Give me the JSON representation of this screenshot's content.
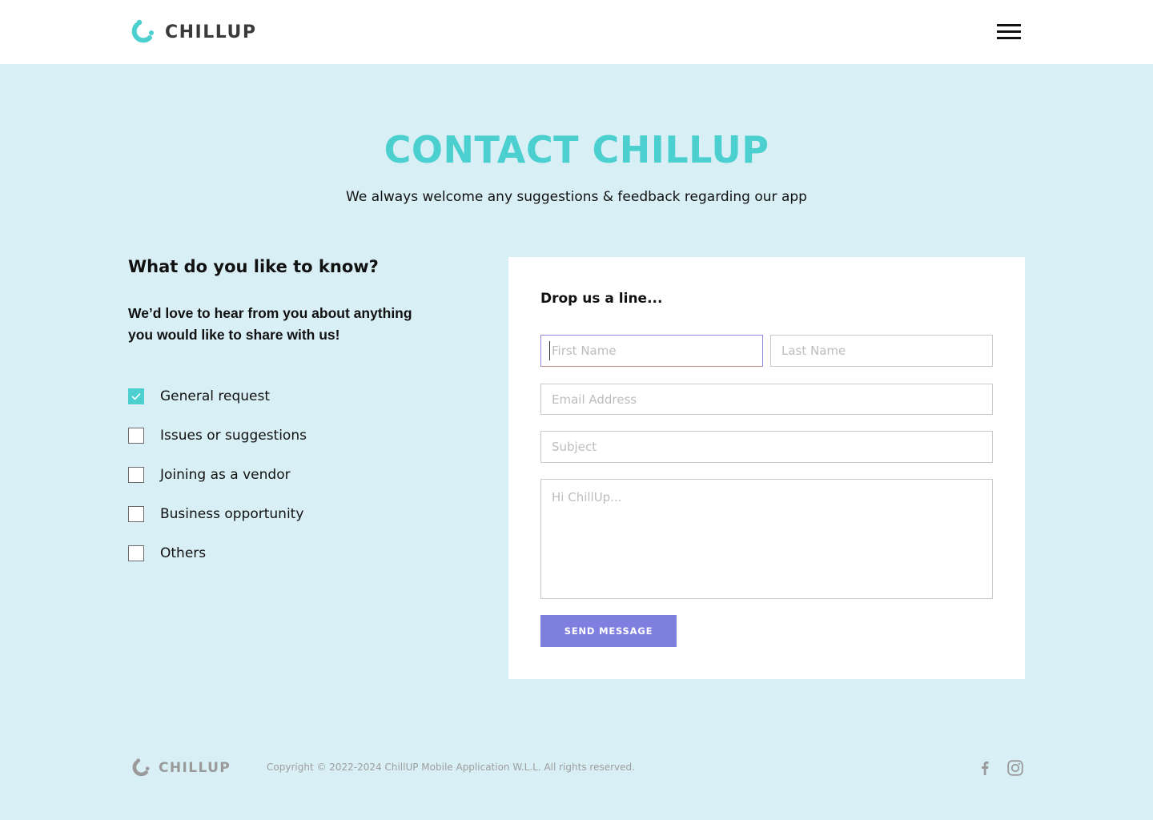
{
  "header": {
    "brand": "CHILLUP",
    "menu_icon": "hamburger-menu-icon"
  },
  "hero": {
    "title": "CONTACT CHILLUP",
    "subtitle": "We always welcome any suggestions & feedback regarding our app"
  },
  "left": {
    "heading": "What do you like to know?",
    "description": "We’d love to hear from you about anything you would like to share with us!",
    "options": [
      {
        "label": "General request",
        "checked": true
      },
      {
        "label": "Issues or suggestions",
        "checked": false
      },
      {
        "label": "Joining as a vendor",
        "checked": false
      },
      {
        "label": "Business opportunity",
        "checked": false
      },
      {
        "label": "Others",
        "checked": false
      }
    ]
  },
  "form": {
    "title": "Drop us a line...",
    "first_name_placeholder": "First Name",
    "last_name_placeholder": "Last Name",
    "email_placeholder": "Email Address",
    "subject_placeholder": "Subject",
    "message_placeholder": "Hi ChillUp...",
    "send_label": "SEND MESSAGE"
  },
  "footer": {
    "brand": "CHILLUP",
    "copyright": "Copyright © 2022-2024 ChillUP Mobile Application W.L.L. All rights reserved.",
    "social": [
      "facebook-icon",
      "instagram-icon"
    ]
  },
  "colors": {
    "accent": "#4ccfcf",
    "button": "#7f7fe0",
    "background": "#d8eff5"
  }
}
